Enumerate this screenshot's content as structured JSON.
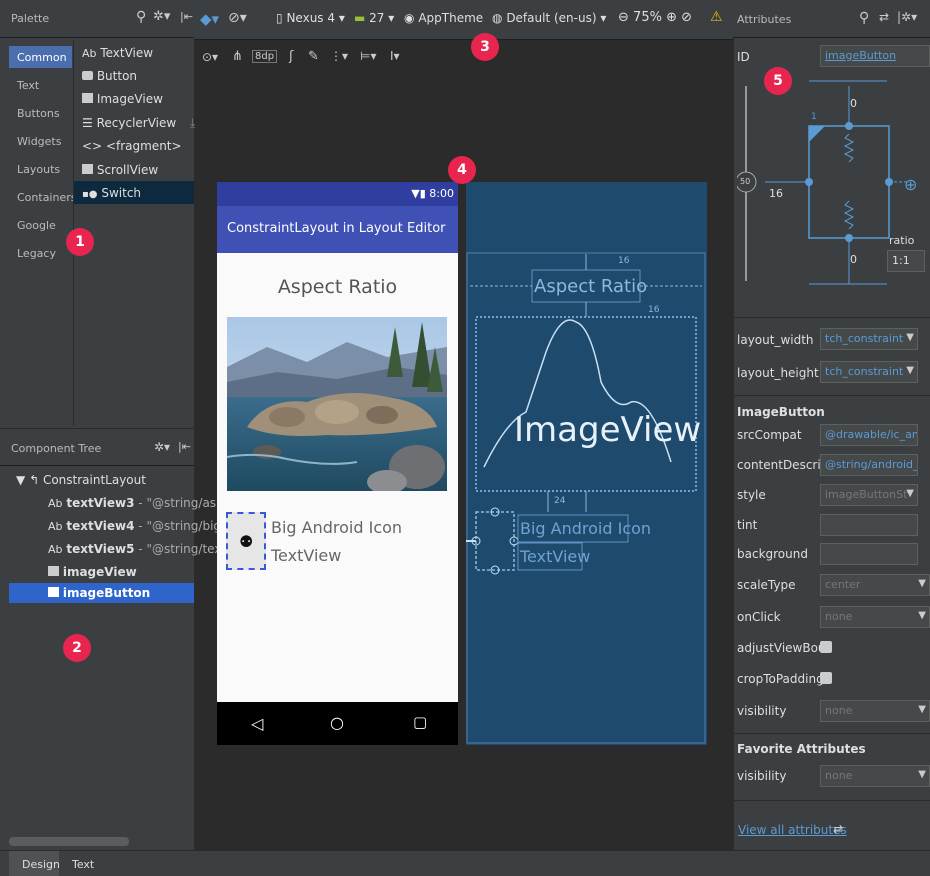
{
  "palette": {
    "title": "Palette",
    "categories": [
      "Common",
      "Text",
      "Buttons",
      "Widgets",
      "Layouts",
      "Containers",
      "Google",
      "Legacy"
    ],
    "items": [
      {
        "icon": "Ab",
        "label": "TextView"
      },
      {
        "icon": "button-icon",
        "label": "Button"
      },
      {
        "icon": "image-icon",
        "label": "ImageView"
      },
      {
        "icon": "list-icon",
        "label": "RecyclerView"
      },
      {
        "icon": "<>",
        "label": "<fragment>"
      },
      {
        "icon": "scroll-icon",
        "label": "ScrollView"
      },
      {
        "icon": "switch-icon",
        "label": "Switch"
      }
    ]
  },
  "component_tree": {
    "title": "Component Tree",
    "root": "ConstraintLayout",
    "rows": [
      {
        "prefix": "Ab",
        "name": "textView3",
        "value": "- \"@string/asp"
      },
      {
        "prefix": "Ab",
        "name": "textView4",
        "value": "- \"@string/big"
      },
      {
        "prefix": "Ab",
        "name": "textView5",
        "value": "- \"@string/tex"
      },
      {
        "prefix": "",
        "name": "imageView",
        "value": ""
      },
      {
        "prefix": "",
        "name": "imageButton",
        "value": ""
      }
    ]
  },
  "toolbar": {
    "device": "Nexus 4",
    "api": "27",
    "theme": "AppTheme",
    "locale": "Default (en-us)",
    "zoom": "75%",
    "margin": "8dp"
  },
  "phone": {
    "time": "8:00",
    "app_title": "ConstraintLayout in Layout Editor",
    "aspect_text": "Aspect Ratio",
    "big_icon_text": "Big Android Icon",
    "textview_text": "TextView"
  },
  "blueprint": {
    "aspect_text": "Aspect Ratio",
    "imageview_text": "ImageView",
    "big_icon_text": "Big Android Icon",
    "textview_text": "TextView",
    "margin_top": "16",
    "margin_bottom": "16",
    "margin_24": "24"
  },
  "attributes": {
    "title": "Attributes",
    "id_label": "ID",
    "id_value": "imageButton",
    "constraint": {
      "top": "0",
      "left": "16",
      "bottom": "0",
      "bias": "50",
      "ratio_label": "ratio",
      "ratio_value": "1:1",
      "corner": "1"
    },
    "layout_width_label": "layout_width",
    "layout_width_value": "tch_constraint",
    "layout_height_label": "layout_height",
    "layout_height_value": "tch_constraint",
    "section": "ImageButton",
    "rows": [
      {
        "label": "srcCompat",
        "value": "@drawable/ic_and"
      },
      {
        "label": "contentDescrip",
        "value": "@string/android_"
      },
      {
        "label": "style",
        "value": "imageButtonSt"
      },
      {
        "label": "tint",
        "value": ""
      },
      {
        "label": "background",
        "value": ""
      },
      {
        "label": "scaleType",
        "value": "center"
      },
      {
        "label": "onClick",
        "value": "none"
      },
      {
        "label": "adjustViewBour",
        "value": ""
      },
      {
        "label": "cropToPadding",
        "value": ""
      },
      {
        "label": "visibility",
        "value": "none"
      }
    ],
    "favorites_title": "Favorite Attributes",
    "fav_visibility_label": "visibility",
    "fav_visibility_value": "none",
    "view_all": "View all attributes"
  },
  "bottom_tabs": [
    "Design",
    "Text"
  ],
  "badges": [
    "1",
    "2",
    "3",
    "4",
    "5"
  ],
  "colors": {
    "accent": "#e8254f",
    "blueprint": "#1e4a6e",
    "selection": "#2f65ca",
    "app_bar": "#3f51b5",
    "status_bar": "#303f9f"
  }
}
